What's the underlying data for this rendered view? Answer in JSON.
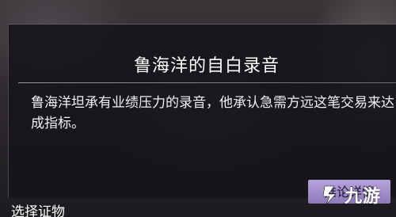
{
  "card": {
    "title": "鲁海洋的自白录音",
    "description": "鲁海洋坦承有业绩压力的录音，他承认急需方远这笔交易来达成指标。",
    "detail_button": "推论详情"
  },
  "bottom_label": "选择证物",
  "watermark": {
    "text": "九游",
    "icon": "jiuyou-logo-icon"
  },
  "colors": {
    "button_top": "#b7a3dd",
    "button_bottom": "#8f7ab9",
    "card_bg": "#16141a"
  }
}
